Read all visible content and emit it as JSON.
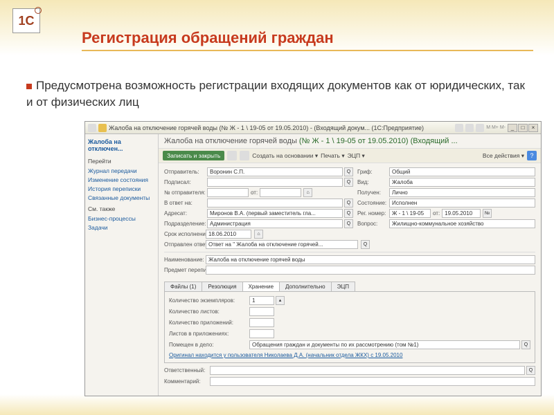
{
  "slide": {
    "title": "Регистрация обращений граждан",
    "description": "Предусмотрена возможность регистрации входящих документов как от юридических, так и от физических лиц"
  },
  "window": {
    "titlebar": "Жалоба на отключение горячей воды (№ Ж - 1 \\ 19-05 от 19.05.2010) - (Входящий докум... (1С:Предприятие)"
  },
  "sidebar": {
    "head": "Жалоба на отключен...",
    "sect1": "Перейти",
    "links1": [
      "Журнал передачи",
      "Изменение состояния",
      "История переписки",
      "Связанные документы"
    ],
    "sect2": "См. также",
    "links2": [
      "Бизнес-процессы",
      "Задачи"
    ]
  },
  "doc": {
    "title_prefix": "Жалоба на отключение горячей воды ",
    "title_suffix": "(№ Ж - 1 \\ 19-05 от 19.05.2010) (Входящий ..."
  },
  "toolbar": {
    "save": "Записать и закрыть",
    "create": "Создать на основании",
    "print": "Печать",
    "ecp": "ЭЦП",
    "actions": "Все действия"
  },
  "form": {
    "sender_lbl": "Отправитель:",
    "sender": "Воронин С.П.",
    "grif_lbl": "Гриф:",
    "grif": "Общий",
    "podpisal_lbl": "Подписал:",
    "podpisal": "",
    "vid_lbl": "Вид:",
    "vid": "Жалоба",
    "numsender_lbl": "№ отправителя:",
    "ot_lbl": "от:",
    "poluchen_lbl": "Получен:",
    "poluchen": "Лично",
    "vreply_lbl": "В ответ на:",
    "sost_lbl": "Состояние:",
    "sost": "Исполнен",
    "adresat_lbl": "Адресат:",
    "adresat": "Миронов В.А. (первый заместитель гла...",
    "regnum_lbl": "Рег. номер:",
    "regnum": "Ж - 1 \\ 19-05",
    "regdate_lbl": "от:",
    "regdate": "19.05.2010",
    "podrazd_lbl": "Подразделение:",
    "podrazd": "Администрация",
    "vopros_lbl": "Вопрос:",
    "vopros": "Жилищно-коммунальное хозяйство",
    "srok_lbl": "Срок исполнения:",
    "srok": "18.06.2010",
    "otvot_lbl": "Отправлен ответ:",
    "otvot": "Ответ на \" Жалоба на отключение горячей...",
    "naim_lbl": "Наименование:",
    "naim": "Жалоба на отключение горячей воды",
    "predmet_lbl": "Предмет переписки:"
  },
  "tabs": {
    "files": "Файлы (1)",
    "resolution": "Резолюция",
    "storage": "Хранение",
    "additional": "Дополнительно",
    "ecp": "ЭЦП"
  },
  "storage": {
    "copies_lbl": "Количество экземпляров:",
    "copies": "1",
    "sheets_lbl": "Количество листов:",
    "attach_lbl": "Количество приложений:",
    "attsheets_lbl": "Листов в приложениях:",
    "delo_lbl": "Помещен в дело:",
    "delo": "Обращения граждан и документы по их рассмотрению (том №1)",
    "original": "Оригинал находится у пользователя Николаева Д.А. (начальник отдела ЖКХ) с 19.05.2010"
  },
  "bottom": {
    "resp_lbl": "Ответственный:",
    "comment_lbl": "Комментарий:"
  }
}
